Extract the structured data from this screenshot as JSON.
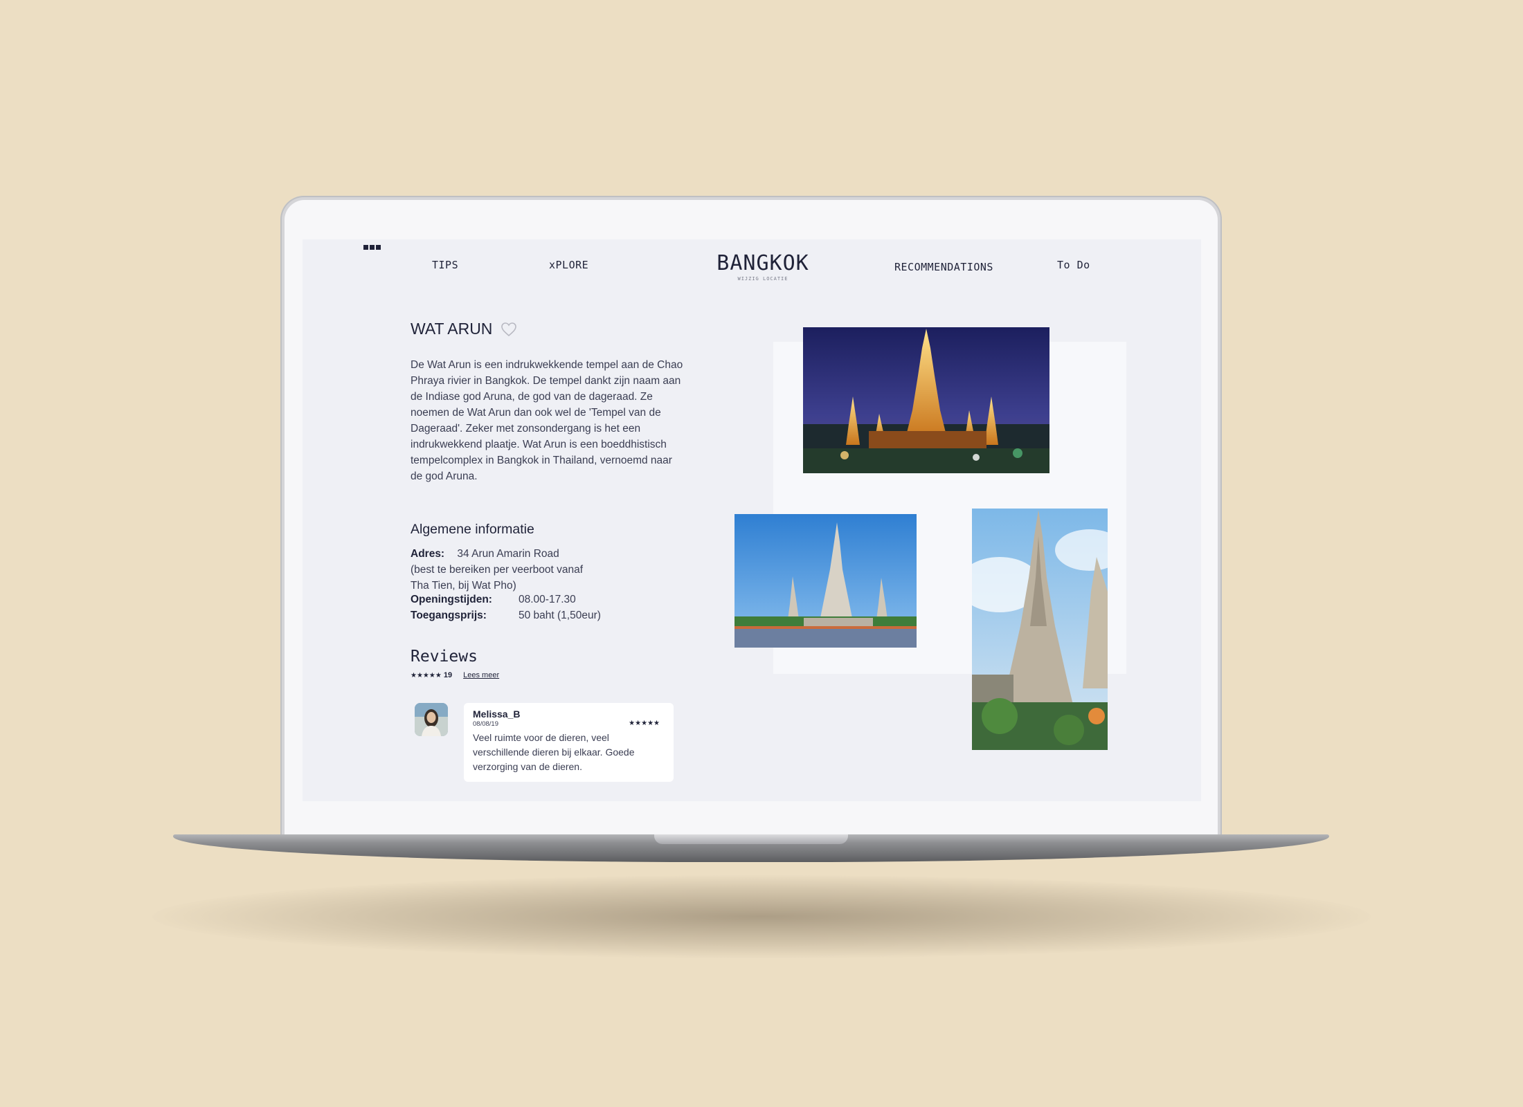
{
  "nav": {
    "tips": "TIPS",
    "explore": "xPLORE",
    "brand": "BANGKOK",
    "brand_sub": "WIJZIG LOCATIE",
    "recommendations": "RECOMMENDATIONS",
    "todo": "To Do"
  },
  "attraction": {
    "title": "WAT ARUN",
    "intro": "De Wat Arun is een indrukwekkende tempel aan de Chao Phraya rivier in Bangkok. De tempel dankt zijn naam aan de Indiase god Aruna, de god van de dageraad. Ze noemen de Wat Arun dan ook wel de 'Tempel van de Dageraad'. Zeker met zonsondergang is het een indrukwekkend plaatje. Wat Arun is een boeddhistisch tempelcomplex in Bangkok in Thailand, vernoemd naar de god Aruna."
  },
  "info": {
    "heading": "Algemene informatie",
    "address_label": "Adres:",
    "address_value": "34 Arun Amarin Road",
    "address_note_1": "(best te bereiken per veerboot vanaf",
    "address_note_2": "Tha Tien, bij Wat Pho)",
    "hours_label": "Openingstijden:",
    "hours_value": "08.00-17.30",
    "price_label": "Toegangsprijs:",
    "price_value": "50 baht  (1,50eur)"
  },
  "reviews": {
    "heading": "Reviews",
    "stars": "★★★★★",
    "count": "19",
    "more": "Lees meer",
    "items": [
      {
        "user": "Melissa_B",
        "date": "08/08/19",
        "stars": "★★★★★",
        "text": "Veel ruimte voor de dieren, veel verschillende dieren bij elkaar. Goede verzorging van de dieren."
      }
    ]
  },
  "colors": {
    "page_bg": "#ecdec3",
    "screen_bg": "#eff0f5",
    "ink": "#1f2238"
  }
}
